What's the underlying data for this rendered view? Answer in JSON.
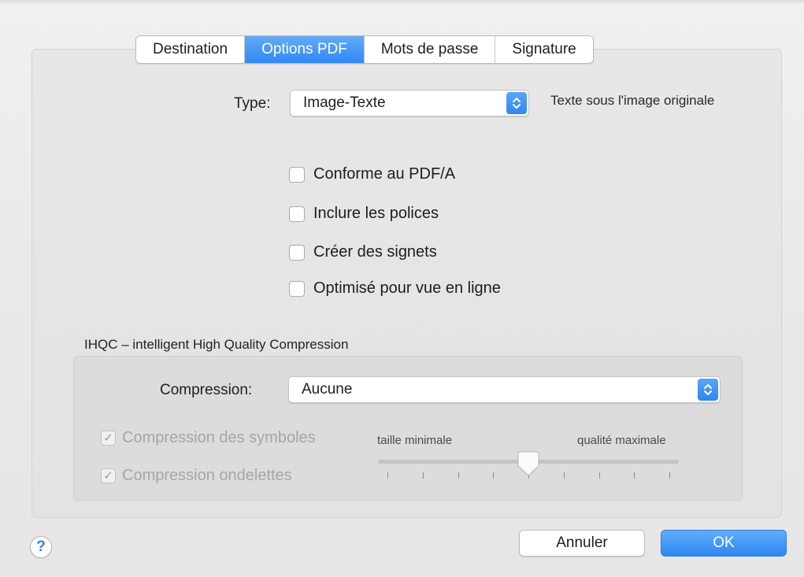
{
  "tabs": [
    {
      "label": "Destination",
      "active": false
    },
    {
      "label": "Options PDF",
      "active": true
    },
    {
      "label": "Mots de passe",
      "active": false
    },
    {
      "label": "Signature",
      "active": false
    }
  ],
  "type_row": {
    "label": "Type:",
    "value": "Image-Texte",
    "note": "Texte sous l'image originale"
  },
  "options": [
    {
      "label": "Conforme au PDF/A",
      "checked": false
    },
    {
      "label": "Inclure les polices",
      "checked": false
    },
    {
      "label": "Créer des signets",
      "checked": false
    },
    {
      "label": "Optimisé pour vue en ligne",
      "checked": false
    }
  ],
  "ihqc": {
    "title": "IHQC – intelligent High Quality Compression",
    "compression_label": "Compression:",
    "compression_value": "Aucune",
    "symbols_label": "Compression des symboles",
    "symbols_checked": true,
    "wavelets_label": "Compression ondelettes",
    "wavelets_checked": true,
    "slider_min_label": "taille minimale",
    "slider_max_label": "qualité maximale",
    "slider_position": 0.5,
    "slider_ticks": 9,
    "enabled": false
  },
  "footer": {
    "help_symbol": "?",
    "cancel_label": "Annuler",
    "ok_label": "OK"
  },
  "colors": {
    "accent": "#2f88f4",
    "disabled_text": "#a6a6a6"
  }
}
